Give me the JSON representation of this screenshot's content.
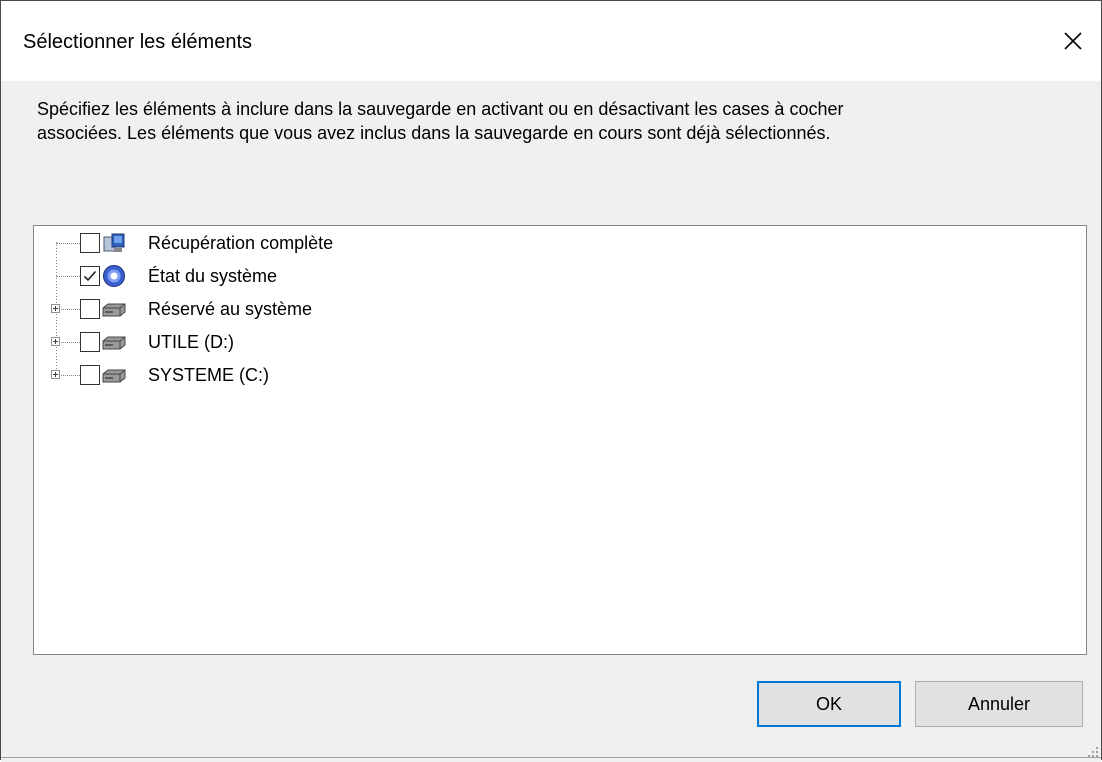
{
  "window": {
    "title": "Sélectionner les éléments"
  },
  "description": {
    "line1": "Spécifiez les éléments à inclure dans la sauvegarde en activant ou en désactivant les cases à cocher",
    "line2": "associées. Les éléments que vous avez inclus dans la sauvegarde en cours sont déjà sélectionnés."
  },
  "tree": {
    "items": [
      {
        "label": "Récupération complète",
        "checked": false,
        "expandable": false,
        "icon": "bare-metal-recovery-icon"
      },
      {
        "label": "État du système",
        "checked": true,
        "expandable": false,
        "icon": "system-state-icon"
      },
      {
        "label": "Réservé au système",
        "checked": false,
        "expandable": true,
        "icon": "drive-icon"
      },
      {
        "label": "UTILE (D:)",
        "checked": false,
        "expandable": true,
        "icon": "drive-icon"
      },
      {
        "label": "SYSTEME (C:)",
        "checked": false,
        "expandable": true,
        "icon": "drive-icon"
      }
    ]
  },
  "buttons": {
    "ok_label": "OK",
    "cancel_label": "Annuler"
  },
  "colors": {
    "accent": "#0078d7",
    "window_bg": "#f0f0f0",
    "button_bg": "#e1e1e1"
  }
}
